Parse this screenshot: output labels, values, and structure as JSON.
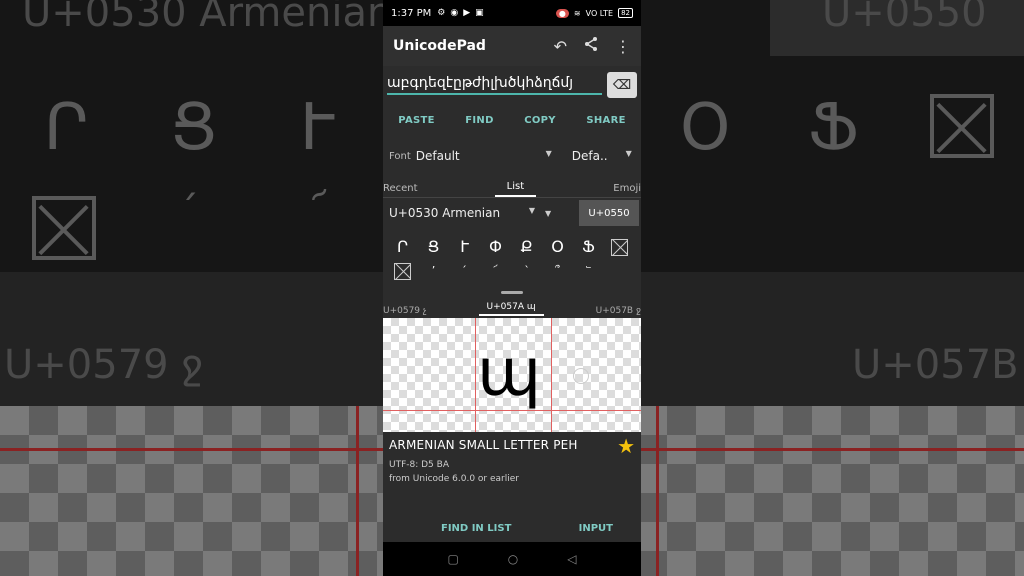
{
  "background": {
    "top_left_range": "U+0530 Armenian",
    "top_right_code": "U+0550",
    "mid_left_code": "U+0579 ջ",
    "mid_right_code": "U+057B ջ",
    "row_glyphs": [
      "Ր",
      "Ց",
      "Ւ",
      "Օ",
      "Ֆ"
    ],
    "row2_glyphs": [
      "՛",
      "՜"
    ]
  },
  "status_bar": {
    "time": "1:37 PM",
    "network": "VO LTE",
    "battery": "82"
  },
  "app_bar": {
    "title": "UnicodePad"
  },
  "edit_text": {
    "value": "աբգդեզէըթժիլխծկհձղճմյ"
  },
  "actions": {
    "paste": "PASTE",
    "find": "FIND",
    "copy": "COPY",
    "share": "SHARE"
  },
  "font_row": {
    "label": "Font",
    "font_value": "Default",
    "variant_value": "Defa.."
  },
  "tabs": {
    "recent": "Recent",
    "list": "List",
    "emoji": "Emoji"
  },
  "range_row": {
    "range": "U+0530 Armenian",
    "code_button": "U+0550"
  },
  "grid": {
    "row1": [
      "Ր",
      "Ց",
      "Ւ",
      "Փ",
      "Ք",
      "Օ",
      "Ֆ"
    ],
    "row2": [
      "՚",
      "՛",
      "՜",
      "՝",
      "՞",
      "՟"
    ]
  },
  "char_tabs": {
    "prev": "U+0579 չ",
    "current": "U+057A պ",
    "next": "U+057B ջ"
  },
  "preview": {
    "glyph": "պ"
  },
  "char_info": {
    "name": "ARMENIAN SMALL LETTER PEH",
    "utf8": "UTF-8: D5 BA",
    "version": "from Unicode 6.0.0 or earlier"
  },
  "bottom_actions": {
    "find_in_list": "FIND IN LIST",
    "input": "INPUT"
  },
  "colors": {
    "accent": "#80cbc4",
    "star": "#f4c20d",
    "guide_line": "#e06060"
  }
}
